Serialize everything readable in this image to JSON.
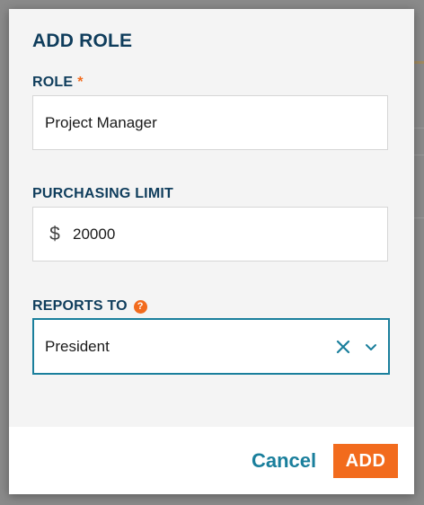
{
  "dialog": {
    "title": "ADD ROLE"
  },
  "fields": {
    "role": {
      "label": "ROLE",
      "required_mark": "*",
      "value": "Project Manager"
    },
    "purchasing_limit": {
      "label": "PURCHASING LIMIT",
      "currency_symbol": "$",
      "value": "20000"
    },
    "reports_to": {
      "label": "REPORTS TO",
      "help_glyph": "?",
      "selected_value": "President"
    }
  },
  "footer": {
    "cancel_label": "Cancel",
    "add_label": "ADD"
  },
  "icons": {
    "help": "help-icon",
    "clear": "clear-icon",
    "chevron": "chevron-down-icon",
    "dollar": "dollar-icon"
  },
  "colors": {
    "heading": "#0f3d5c",
    "accent_orange": "#f26b1d",
    "accent_teal": "#1a7f9c",
    "modal_background": "#f4f4f4"
  }
}
